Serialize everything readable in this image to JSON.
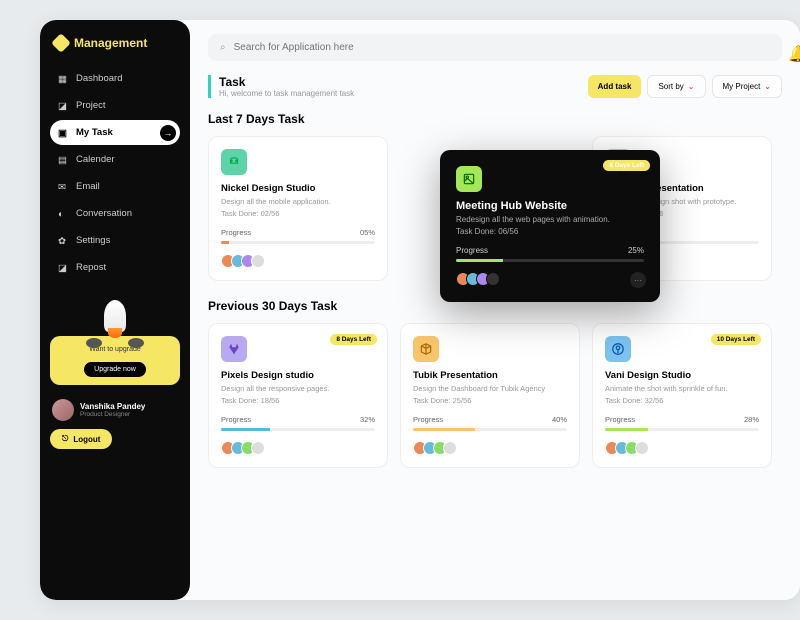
{
  "url": "www.nickelfox.com",
  "brand": "Management",
  "search": {
    "placeholder": "Search for Application here"
  },
  "nav": [
    {
      "label": "Dashboard"
    },
    {
      "label": "Project"
    },
    {
      "label": "My Task"
    },
    {
      "label": "Calender"
    },
    {
      "label": "Email"
    },
    {
      "label": "Conversation"
    },
    {
      "label": "Settings"
    },
    {
      "label": "Repost"
    }
  ],
  "upgrade": {
    "text": "Want to upgrade",
    "btn": "Upgrade now"
  },
  "user": {
    "name": "Vanshika Pandey",
    "role": "Product Designer"
  },
  "logout": "Logout",
  "header": {
    "title": "Task",
    "sub": "Hi, welcome to task management task"
  },
  "actions": {
    "add": "Add task",
    "sort": "Sort by",
    "filter": "My Project"
  },
  "section1": "Last 7 Days Task",
  "section2": "Previous 30 Days Task",
  "cards7": [
    {
      "title": "Nickel Design Studio",
      "desc": "Design all the mobile application.",
      "done": "Task Done: 02/56",
      "p": "05%"
    },
    {
      "title": "Meeting Hub Website",
      "desc": "Redesign all the web pages with animation.",
      "done": "Task Done: 06/56",
      "p": "25%",
      "badge": "6 Days Left"
    },
    {
      "title": "Dribbble Presentation",
      "desc": "Animate the design shot with prototype.",
      "done": "Task Done: 08/56",
      "p": ""
    }
  ],
  "cards30": [
    {
      "title": "Pixels Design studio",
      "desc": "Design all the responsive pages.",
      "done": "Task Done: 18/56",
      "p": "32%",
      "badge": "8 Days Left"
    },
    {
      "title": "Tubik Presentation",
      "desc": "Design the Dashboard for Tubik Agency",
      "done": "Task Done: 25/56",
      "p": "40%"
    },
    {
      "title": "Vani Design Studio",
      "desc": "Animate the shot with sprinkle of fun.",
      "done": "Task Done: 32/56",
      "p": "28%",
      "badge": "10 Days Left"
    }
  ],
  "progress_label": "Progress"
}
